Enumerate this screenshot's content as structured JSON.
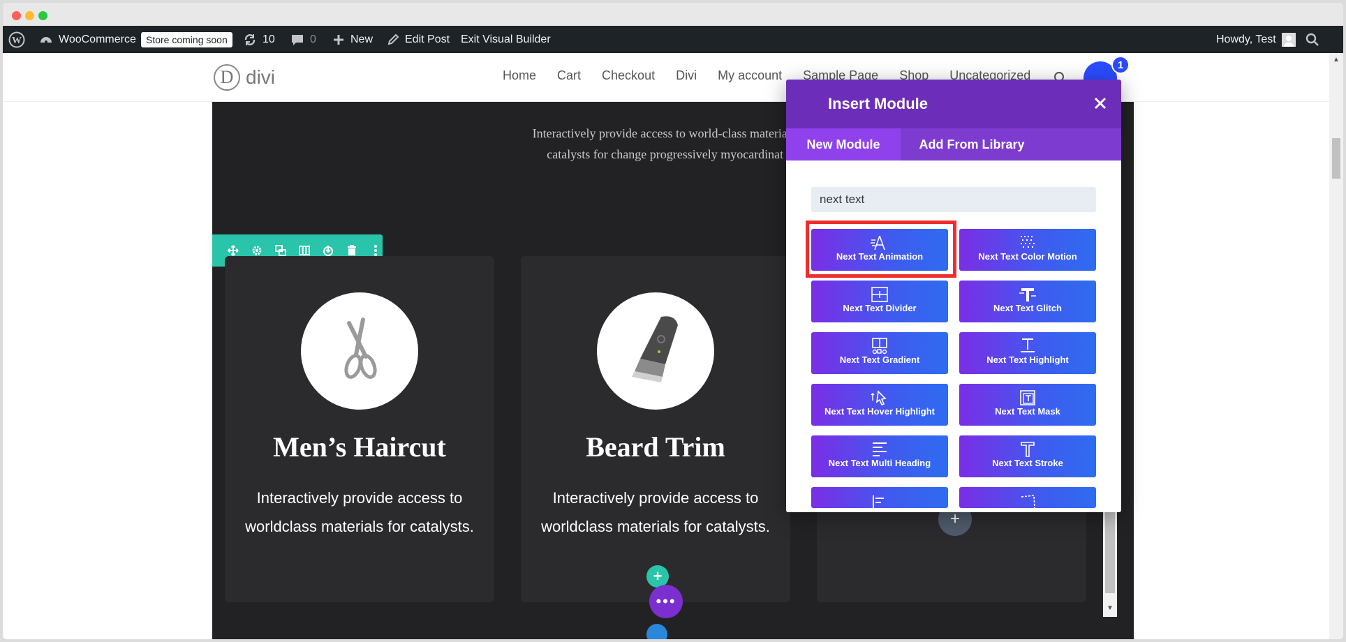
{
  "admin_bar": {
    "wordpress_icon": "wordpress-icon",
    "site_name": "WooCommerce",
    "store_badge": "Store coming soon",
    "updates_count": "10",
    "comments_count": "0",
    "new_label": "New",
    "edit_post_label": "Edit Post",
    "exit_builder_label": "Exit Visual Builder",
    "howdy_label": "Howdy, Test"
  },
  "site": {
    "logo_text": "divi",
    "logo_letter": "D",
    "nav_items": [
      "Home",
      "Cart",
      "Checkout",
      "Divi",
      "My account",
      "Sample Page",
      "Shop",
      "Uncategorized"
    ],
    "cart_count": "1"
  },
  "section": {
    "intro_line1": "Interactively provide access to world-class materials for",
    "intro_line2": "catalysts for change progressively myocardinat go",
    "cards": [
      {
        "title": "Men’s Haircut",
        "text": "Interactively provide access to worldclass materials for catalysts.",
        "icon": "scissors-icon"
      },
      {
        "title": "Beard Trim",
        "text": "Interactively provide access to worldclass materials for catalysts.",
        "icon": "trimmer-icon"
      }
    ],
    "add_plus": "+",
    "more_dots": "•••"
  },
  "modal": {
    "title": "Insert Module",
    "tabs": [
      "New Module",
      "Add From Library"
    ],
    "search_value": "next text",
    "modules": [
      "Next Text Animation",
      "Next Text Color Motion",
      "Next Text Divider",
      "Next Text Glitch",
      "Next Text Gradient",
      "Next Text Highlight",
      "Next Text Hover Highlight",
      "Next Text Mask",
      "Next Text Multi Heading",
      "Next Text Stroke"
    ],
    "selected_module": "Next Text Animation"
  },
  "colors": {
    "admin_bar": "#1d2327",
    "divi_teal": "#29c4a9",
    "divi_purple": "#6c2eb9",
    "module_gradient_start": "#7a2ee6",
    "module_gradient_end": "#2e6cf0",
    "highlight_red": "#ee2e2e"
  }
}
